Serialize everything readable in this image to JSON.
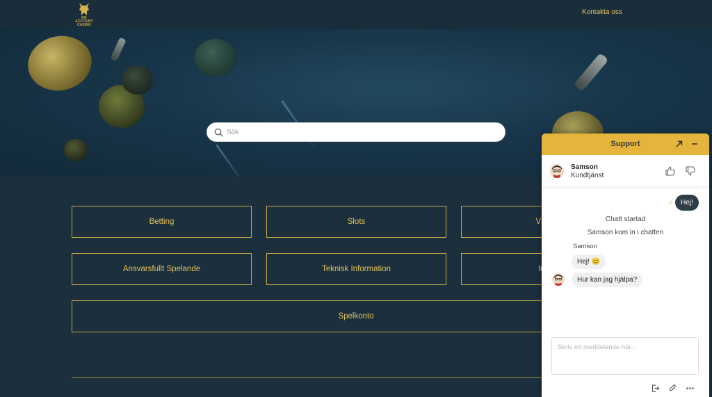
{
  "header": {
    "logo_alt": "No Account Casino logo",
    "logo_line1": "NO ACCOUNT",
    "logo_line2": "CASINO",
    "contact_label": "Kontakta oss"
  },
  "search": {
    "placeholder": "Sök",
    "icon": "search-icon"
  },
  "categories": [
    {
      "label": "Betting"
    },
    {
      "label": "Slots"
    },
    {
      "label": "Välkoms"
    },
    {
      "label": "Ansvarsfullt Spelande"
    },
    {
      "label": "Teknisk Information"
    },
    {
      "label": "Insättni"
    },
    {
      "label": "Spelkonto"
    }
  ],
  "support": {
    "title": "Support",
    "agent_name": "Samson",
    "agent_role": "Kundtjänst",
    "my_message": "Hej!",
    "system_messages": [
      "Chatt startad",
      "Samson kom in i chatten"
    ],
    "sender_label": "Samson",
    "agent_messages": [
      "Hej! 😊",
      "Hur kan jag hjälpa?"
    ],
    "input_placeholder": "Skriv ett meddelande här...",
    "colors": {
      "accent": "#e4b43d",
      "my_bubble": "#2f3d46",
      "their_bubble": "#eef0f2"
    }
  },
  "colors": {
    "page_bg": "#1b2f3c",
    "gold": "#c9a94b",
    "gold_text": "#e2c15d"
  }
}
